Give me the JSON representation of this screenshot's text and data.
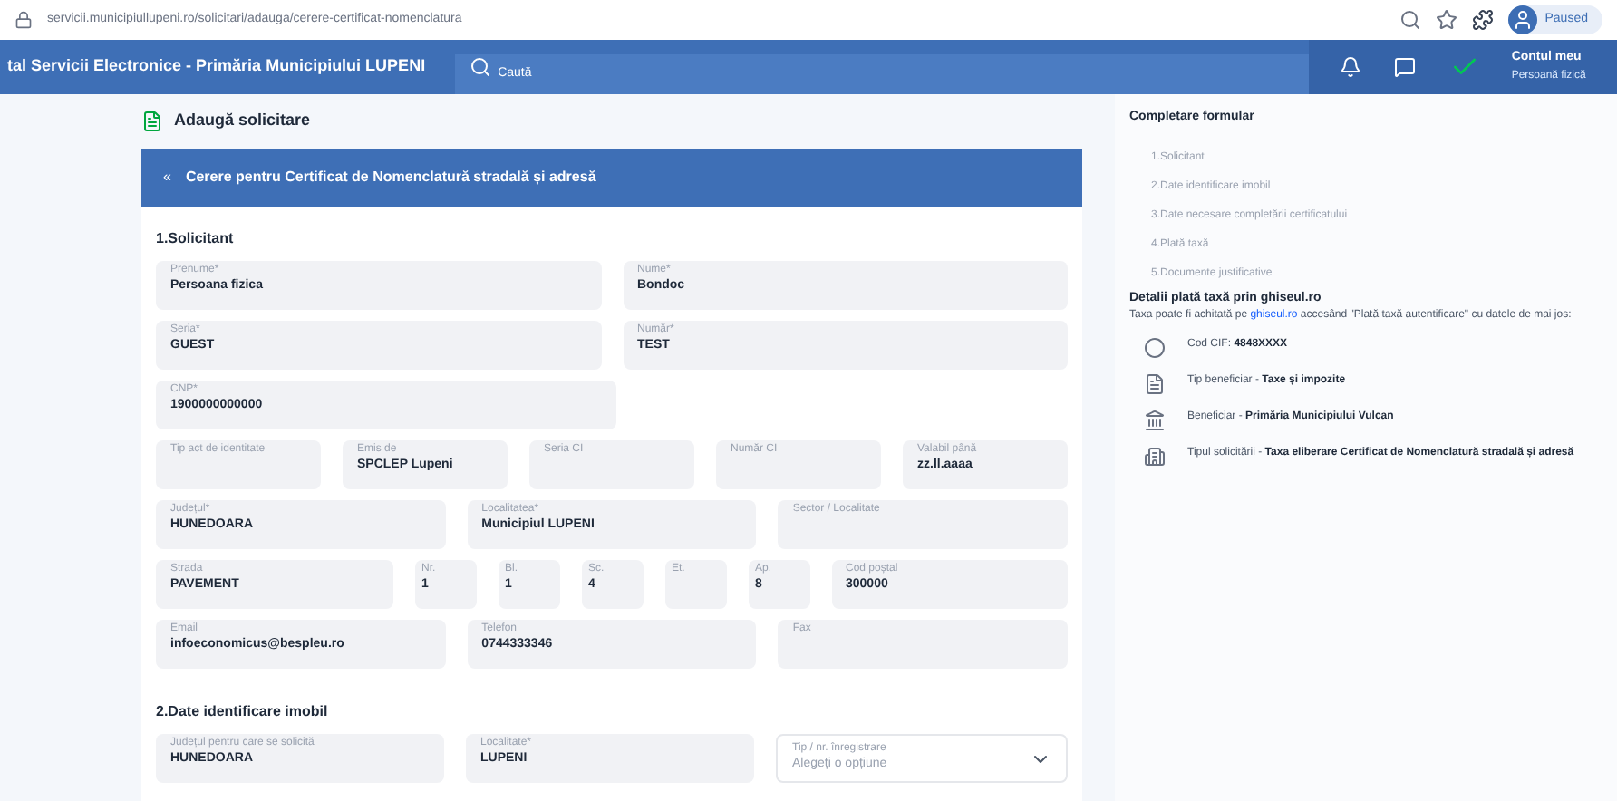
{
  "browser": {
    "url": "servicii.municipiullupeni.ro/solicitari/adauga/cerere-certificat-nomenclatura",
    "profile": "Paused"
  },
  "header": {
    "title": "tal Servicii Electronice - Primăria Municipiului LUPENI",
    "search": {
      "placeholder": "Caută"
    },
    "user": {
      "name": "Contul meu",
      "role": "Persoană fizică"
    }
  },
  "page_title": "Adaugă solicitare",
  "form": {
    "title": "Cerere pentru Certificat de Nomenclatură stradală și adresă",
    "back": "«",
    "sections": [
      {
        "title": "1.Solicitant",
        "rows": [
          {
            "fields": [
              {
                "label": "Prenume*",
                "value": "Persoana fizica",
                "kind": "text"
              },
              {
                "label": "Nume*",
                "value": "Bondoc",
                "kind": "text"
              }
            ]
          },
          {
            "fields": [
              {
                "label": "Seria*",
                "value": "GUEST",
                "kind": "text"
              },
              {
                "label": "Număr*",
                "value": "TEST",
                "kind": "text"
              }
            ]
          },
          {
            "fields": [
              {
                "label": "CNP*",
                "value": "1900000000000",
                "kind": "half"
              }
            ]
          },
          {
            "fields": [
              {
                "label": "Tip act de identitate",
                "kind": "text"
              },
              {
                "label": "Emis de",
                "value": "SPCLEP Lupeni",
                "kind": "text"
              },
              {
                "label": "Seria CI",
                "kind": "text"
              },
              {
                "label": "Număr CI",
                "kind": "text"
              },
              {
                "label": "Valabil până",
                "value": "zz.ll.aaaa",
                "kind": "text"
              }
            ]
          },
          {
            "fields": [
              {
                "label": "Județul*",
                "value": "HUNEDOARA",
                "kind": "text"
              },
              {
                "label": "Localitatea*",
                "value": "Municipiul LUPENI",
                "kind": "text"
              },
              {
                "label": "Sector / Localitate",
                "kind": "text"
              }
            ]
          },
          {
            "fields": [
              {
                "label": "Strada",
                "value": "PAVEMENT",
                "kind": "text"
              },
              {
                "label": "Nr.",
                "value": "1",
                "kind": "short"
              },
              {
                "label": "Bl.",
                "value": "1",
                "kind": "short"
              },
              {
                "label": "Sc.",
                "value": "4",
                "kind": "short"
              },
              {
                "label": "Et.",
                "kind": "short"
              },
              {
                "label": "Ap.",
                "value": "8",
                "kind": "short"
              },
              {
                "label": "Cod poștal",
                "value": "300000",
                "kind": "text"
              }
            ]
          },
          {
            "fields": [
              {
                "label": "Email",
                "value": "infoeconomicus@bespleu.ro",
                "kind": "text"
              },
              {
                "label": "Telefon",
                "value": "0744333346",
                "kind": "text"
              },
              {
                "label": "Fax",
                "kind": "text"
              }
            ]
          }
        ]
      },
      {
        "title": "2.Date identificare imobil",
        "rows": [
          {
            "fields": [
              {
                "label": "Județul pentru care se solicită",
                "value": "HUNEDOARA",
                "kind": "text"
              },
              {
                "label": "Localitate*",
                "value": "LUPENI",
                "kind": "text"
              },
              {
                "label": "Tip / nr. înregistrare",
                "placeholder": "Alegeți o opțiune",
                "kind": "select"
              }
            ]
          }
        ]
      }
    ]
  },
  "sidebar": {
    "title": "Completare formular",
    "steps": [
      "1.Solicitant",
      "2.Date identificare imobil",
      "3.Date necesare completării certificatului",
      "4.Plată taxă",
      "5.Documente justificative"
    ],
    "payment_title": "Detalii plată taxă prin ghiseul.ro",
    "payment_intro": "Taxa poate fi achitată pe ",
    "payment_link": "ghiseul.ro",
    "payment_outro": " accesând \"Plată taxă autentificare\" cu datele de mai jos:",
    "details": [
      {
        "kind": "code",
        "label": "Cod CIF: ",
        "value": "4848XXXX"
      },
      {
        "kind": "type",
        "label": "Tip beneficiar - ",
        "value": "Taxe și impozite"
      },
      {
        "kind": "beneficiary",
        "label": "Beneficiar - ",
        "value": "Primăria Municipiului Vulcan"
      },
      {
        "kind": "request",
        "label": "Tipul solicitării - ",
        "value": "Taxa eliberare Certificat de Nomenclatură stradală și adresă"
      }
    ]
  }
}
